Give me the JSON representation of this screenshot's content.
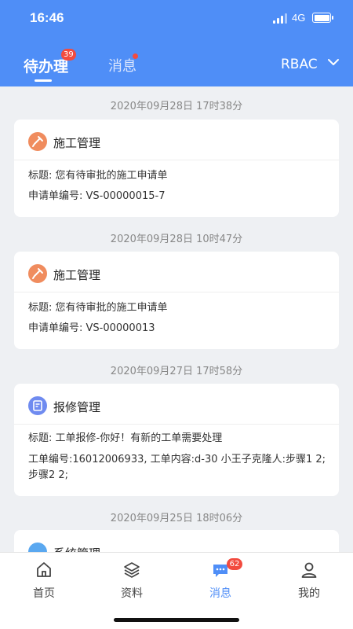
{
  "status_bar": {
    "time": "16:46",
    "network": "4G"
  },
  "header": {
    "tabs": [
      {
        "label": "待办理",
        "badge": "39",
        "active": true
      },
      {
        "label": "消息",
        "dot": true,
        "active": false
      }
    ],
    "role": "RBAC"
  },
  "feed": [
    {
      "date": "2020年09月28日 17时38分",
      "category": "施工管理",
      "icon": "shovel-icon",
      "lines": [
        "标题: 您有待审批的施工申请单",
        "申请单编号: VS-00000015-7"
      ]
    },
    {
      "date": "2020年09月28日 10时47分",
      "category": "施工管理",
      "icon": "shovel-icon",
      "lines": [
        "标题: 您有待审批的施工申请单",
        "申请单编号: VS-00000013"
      ]
    },
    {
      "date": "2020年09月27日 17时58分",
      "category": "报修管理",
      "icon": "repair-doc-icon",
      "lines": [
        "标题: 工单报修-你好！有新的工单需要处理",
        "工单编号:16012006933, 工单内容:d-30 小王子克隆人:步骤1 2;",
        "步骤2 2;"
      ]
    },
    {
      "date": "2020年09月25日 18时06分",
      "category": "系统管理",
      "icon": "system-icon",
      "lines": []
    }
  ],
  "tabbar": [
    {
      "label": "首页",
      "icon": "home-icon",
      "active": false
    },
    {
      "label": "资料",
      "icon": "layers-icon",
      "active": false
    },
    {
      "label": "消息",
      "icon": "chat-icon",
      "active": true,
      "badge": "62"
    },
    {
      "label": "我的",
      "icon": "profile-icon",
      "active": false
    }
  ],
  "colors": {
    "primary": "#4f8ef7",
    "badge": "#f24b3f",
    "background": "#eef0f3"
  }
}
